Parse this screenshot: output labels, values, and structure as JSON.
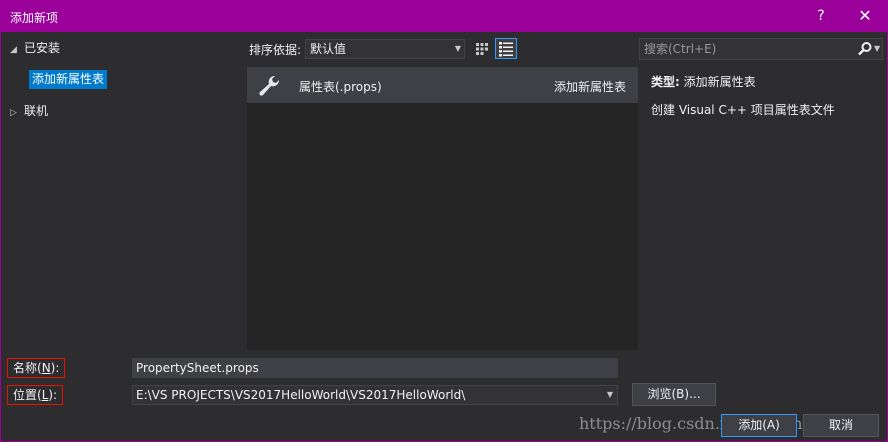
{
  "window": {
    "title": "添加新项",
    "help_glyph": "?",
    "close_glyph": "✕"
  },
  "tree": {
    "installed": {
      "label": "已安装",
      "arrow": "◢"
    },
    "selected": {
      "label": "添加新属性表"
    },
    "online": {
      "label": "联机",
      "arrow": "▷"
    }
  },
  "toolbar": {
    "sort_label": "排序依据:",
    "sort_value": "默认值"
  },
  "search": {
    "placeholder": "搜索(Ctrl+E)"
  },
  "list": {
    "items": [
      {
        "name": "属性表(.props)",
        "category": "添加新属性表",
        "icon": "wrench-icon"
      }
    ]
  },
  "details": {
    "type_label": "类型:",
    "type_value": "添加新属性表",
    "description": "创建 Visual C++ 项目属性表文件"
  },
  "form": {
    "name_label_pre": "名称(",
    "name_label_key": "N",
    "name_label_post": "):",
    "name_value": "PropertySheet.props",
    "location_label_pre": "位置(",
    "location_label_key": "L",
    "location_label_post": "):",
    "location_value": "E:\\VS PROJECTS\\VS2017HelloWorld\\VS2017HelloWorld\\",
    "browse_label": "浏览(B)...",
    "add_label": "添加(A)",
    "cancel_label": "取消"
  },
  "watermark": "https://blog.csdn.net/jayrango",
  "colors": {
    "titlebar": "#9b009b",
    "accent": "#007acc",
    "highlight_border": "#e51400"
  }
}
